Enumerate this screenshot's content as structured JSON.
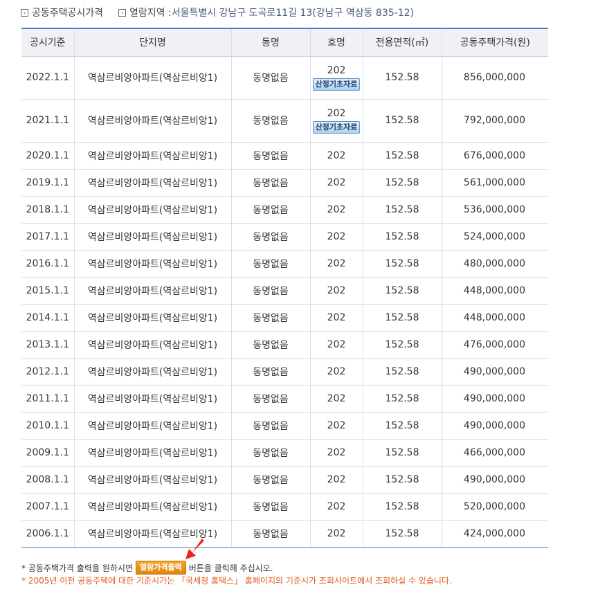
{
  "breadcrumb": {
    "title": "공동주택공시가격",
    "region_label": "열람지역 : ",
    "region_value": "서울특별시 강남구 도곡로11길 13(강남구 역삼동 835-12)"
  },
  "table": {
    "headers": [
      "공시기준",
      "단지명",
      "동명",
      "호명",
      "전용면적(㎡)",
      "공동주택가격(원)"
    ],
    "calc_button_label": "산정기초자료",
    "rows": [
      {
        "date": "2022.1.1",
        "complex": "역삼르비앙아파트(역삼르비앙1)",
        "dong": "동명없음",
        "ho": "202",
        "area": "152.58",
        "price": "856,000,000"
      },
      {
        "date": "2021.1.1",
        "complex": "역삼르비앙아파트(역삼르비앙1)",
        "dong": "동명없음",
        "ho": "202",
        "area": "152.58",
        "price": "792,000,000"
      },
      {
        "date": "2020.1.1",
        "complex": "역삼르비앙아파트(역삼르비앙1)",
        "dong": "동명없음",
        "ho": "202",
        "area": "152.58",
        "price": "676,000,000"
      },
      {
        "date": "2019.1.1",
        "complex": "역삼르비앙아파트(역삼르비앙1)",
        "dong": "동명없음",
        "ho": "202",
        "area": "152.58",
        "price": "561,000,000"
      },
      {
        "date": "2018.1.1",
        "complex": "역삼르비앙아파트(역삼르비앙1)",
        "dong": "동명없음",
        "ho": "202",
        "area": "152.58",
        "price": "536,000,000"
      },
      {
        "date": "2017.1.1",
        "complex": "역삼르비앙아파트(역삼르비앙1)",
        "dong": "동명없음",
        "ho": "202",
        "area": "152.58",
        "price": "524,000,000"
      },
      {
        "date": "2016.1.1",
        "complex": "역삼르비앙아파트(역삼르비앙1)",
        "dong": "동명없음",
        "ho": "202",
        "area": "152.58",
        "price": "480,000,000"
      },
      {
        "date": "2015.1.1",
        "complex": "역삼르비앙아파트(역삼르비앙1)",
        "dong": "동명없음",
        "ho": "202",
        "area": "152.58",
        "price": "448,000,000"
      },
      {
        "date": "2014.1.1",
        "complex": "역삼르비앙아파트(역삼르비앙1)",
        "dong": "동명없음",
        "ho": "202",
        "area": "152.58",
        "price": "448,000,000"
      },
      {
        "date": "2013.1.1",
        "complex": "역삼르비앙아파트(역삼르비앙1)",
        "dong": "동명없음",
        "ho": "202",
        "area": "152.58",
        "price": "476,000,000"
      },
      {
        "date": "2012.1.1",
        "complex": "역삼르비앙아파트(역삼르비앙1)",
        "dong": "동명없음",
        "ho": "202",
        "area": "152.58",
        "price": "490,000,000"
      },
      {
        "date": "2011.1.1",
        "complex": "역삼르비앙아파트(역삼르비앙1)",
        "dong": "동명없음",
        "ho": "202",
        "area": "152.58",
        "price": "490,000,000"
      },
      {
        "date": "2010.1.1",
        "complex": "역삼르비앙아파트(역삼르비앙1)",
        "dong": "동명없음",
        "ho": "202",
        "area": "152.58",
        "price": "490,000,000"
      },
      {
        "date": "2009.1.1",
        "complex": "역삼르비앙아파트(역삼르비앙1)",
        "dong": "동명없음",
        "ho": "202",
        "area": "152.58",
        "price": "466,000,000"
      },
      {
        "date": "2008.1.1",
        "complex": "역삼르비앙아파트(역삼르비앙1)",
        "dong": "동명없음",
        "ho": "202",
        "area": "152.58",
        "price": "490,000,000"
      },
      {
        "date": "2007.1.1",
        "complex": "역삼르비앙아파트(역삼르비앙1)",
        "dong": "동명없음",
        "ho": "202",
        "area": "152.58",
        "price": "520,000,000"
      },
      {
        "date": "2006.1.1",
        "complex": "역삼르비앙아파트(역삼르비앙1)",
        "dong": "동명없음",
        "ho": "202",
        "area": "152.58",
        "price": "424,000,000"
      }
    ]
  },
  "notes": {
    "note1_prefix": "* 공동주택가격 출력을 원하시면",
    "print_button_label": "열람가격출력",
    "note1_suffix": "버튼을 클릭해 주십시오.",
    "note2": "* 2005년 이전 공동주택에 대한 기준시가는 「국세청 홈택스」 홈페이지의 기준시가 조회사이트에서 조회하실 수 있습니다."
  },
  "colors": {
    "accent_border": "#4b7ec1",
    "note_orange": "#e05a1c",
    "arrow_red": "#e8261c"
  },
  "icons": {
    "bullet": "arrow-box-icon",
    "pointer": "red-arrow-icon"
  }
}
